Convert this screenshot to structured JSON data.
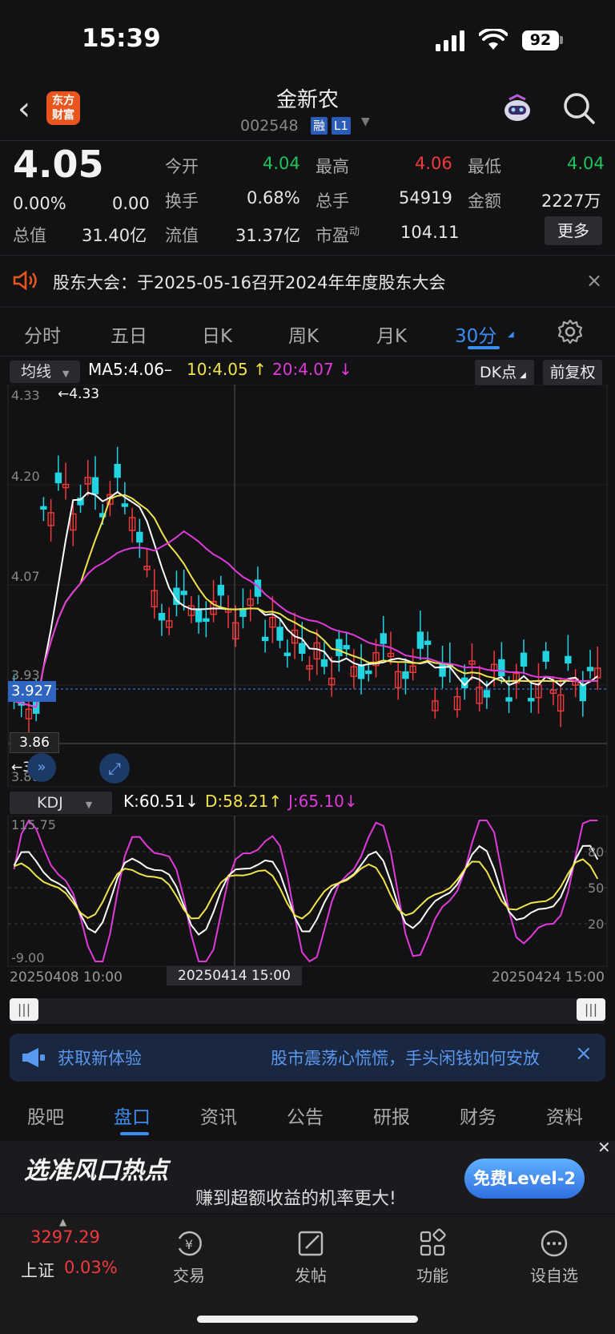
{
  "status": {
    "time": "15:39",
    "battery": "92"
  },
  "header": {
    "logo_text": "东方财富",
    "stock_name": "金新农",
    "stock_code": "002548",
    "tag1": "融",
    "tag2": "L1"
  },
  "quote": {
    "price": "4.05",
    "change_pct": "0.00%",
    "change": "0.00",
    "open_label": "今开",
    "open": "4.04",
    "high_label": "最高",
    "high": "4.06",
    "low_label": "最低",
    "low": "4.04",
    "turnover_label": "换手",
    "turnover": "0.68%",
    "volume_label": "总手",
    "volume": "54919",
    "amount_label": "金额",
    "amount": "2227万",
    "mktcap_label": "总值",
    "mktcap": "31.40亿",
    "float_label": "流值",
    "float": "31.37亿",
    "pe_label": "市盈",
    "pe_sup": "动",
    "pe": "104.11",
    "more_label": "更多"
  },
  "notice": {
    "text": "股东大会：于2025-05-16召开2024年年度股东大会"
  },
  "kline_tabs": [
    "分时",
    "五日",
    "日K",
    "周K",
    "月K",
    "30分"
  ],
  "chart": {
    "ma_select": "均线",
    "ma5": "MA5:4.06–",
    "ma10": "10:4.05",
    "ma20": "20:4.07",
    "dk_label": "DK点",
    "fq_label": "前复权",
    "y_labels": [
      "4.33",
      "4.20",
      "4.07",
      "3.93",
      "3.80"
    ],
    "max_marker": "←4.33",
    "min_marker": "←3.80",
    "current_price_tag": "3.927",
    "cursor_price_tag": "3.86"
  },
  "kdj": {
    "select": "KDJ",
    "k": "K:60.51",
    "d": "D:58.21",
    "j": "J:65.10",
    "y_top": "115.75",
    "y_bottom": "-9.00",
    "levels": [
      "80",
      "50",
      "20"
    ]
  },
  "dates": {
    "start": "20250408 10:00",
    "cursor": "20250414 15:00",
    "end": "20250424 15:00"
  },
  "banner": {
    "left_text": "获取新体验",
    "right_text": "股市震荡心慌慌，手头闲钱如何安放"
  },
  "bottom_tabs": [
    "股吧",
    "盘口",
    "资讯",
    "公告",
    "研报",
    "财务",
    "资料"
  ],
  "ad": {
    "title": "选准风口热点",
    "subtitle": "赚到超额收益的机率更大!",
    "button": "免费Level-2"
  },
  "nav": {
    "index_value": "3297.29",
    "index_name": "上证",
    "index_change": "0.03%",
    "items": [
      "交易",
      "发帖",
      "功能",
      "设自选"
    ]
  },
  "colors": {
    "up": "#f23a3a",
    "down": "#1fc35b",
    "accent": "#3a8ef0",
    "ma5": "#ffffff",
    "ma10": "#f0e44a",
    "ma20": "#e03ad8",
    "candle_up": "#f23a3a",
    "candle_down": "#22d3e0"
  }
}
